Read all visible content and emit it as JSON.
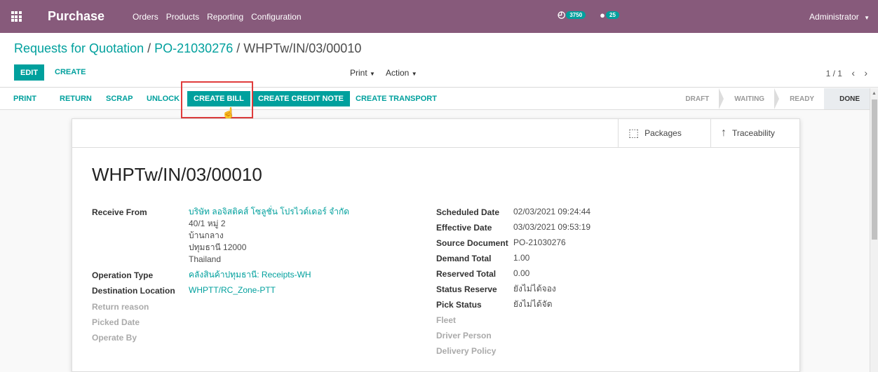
{
  "navbar": {
    "brand": "Purchase",
    "menu": [
      "Orders",
      "Products",
      "Reporting",
      "Configuration"
    ],
    "activity_badge": "3750",
    "message_badge": "25",
    "user": "Administrator"
  },
  "control": {
    "breadcrumb_root": "Requests for Quotation",
    "breadcrumb_po": "PO-21030276",
    "breadcrumb_current": "WHPTw/IN/03/00010",
    "edit_label": "EDIT",
    "create_label": "CREATE",
    "print_label": "Print",
    "action_label": "Action",
    "pager_text": "1 / 1"
  },
  "statusbar": {
    "buttons": [
      "PRINT",
      "RETURN",
      "SCRAP",
      "UNLOCK",
      "CREATE BILL",
      "CREATE CREDIT NOTE",
      "CREATE TRANSPORT"
    ],
    "stages": [
      "DRAFT",
      "WAITING",
      "READY",
      "DONE"
    ],
    "active_stage": "DONE"
  },
  "smart_buttons": {
    "packages": "Packages",
    "traceability": "Traceability"
  },
  "record": {
    "name": "WHPTw/IN/03/00010",
    "left_fields": {
      "receive_from_label": "Receive From",
      "receive_from_value": "บริษัท ลอจิสติคส์ โซลูชั่น โปรไวด์เดอร์ จำกัด",
      "address_lines": [
        "40/1 หมู่ 2",
        "บ้านกลาง",
        "ปทุมธานี 12000",
        "Thailand"
      ],
      "operation_type_label": "Operation Type",
      "operation_type_value": "คลังสินค้าปทุมธานี: Receipts-WH",
      "destination_label": "Destination Location",
      "destination_value": "WHPTT/RC_Zone-PTT",
      "return_reason_label": "Return reason",
      "picked_date_label": "Picked Date",
      "operate_by_label": "Operate By"
    },
    "right_fields": [
      {
        "label": "Scheduled Date",
        "value": "02/03/2021 09:24:44"
      },
      {
        "label": "Effective Date",
        "value": "03/03/2021 09:53:19"
      },
      {
        "label": "Source Document",
        "value": "PO-21030276"
      },
      {
        "label": "Demand Total",
        "value": "1.00"
      },
      {
        "label": "Reserved Total",
        "value": "0.00"
      },
      {
        "label": "Status Reserve",
        "value": "ยังไม่ได้จอง"
      },
      {
        "label": "Pick Status",
        "value": "ยังไม่ได้จัด"
      }
    ],
    "right_muted_labels": [
      "Fleet",
      "Driver Person",
      "Delivery Policy"
    ]
  },
  "colors": {
    "navbar": "#875a7b",
    "accent": "#00a09d",
    "highlight": "#e03c3c"
  }
}
